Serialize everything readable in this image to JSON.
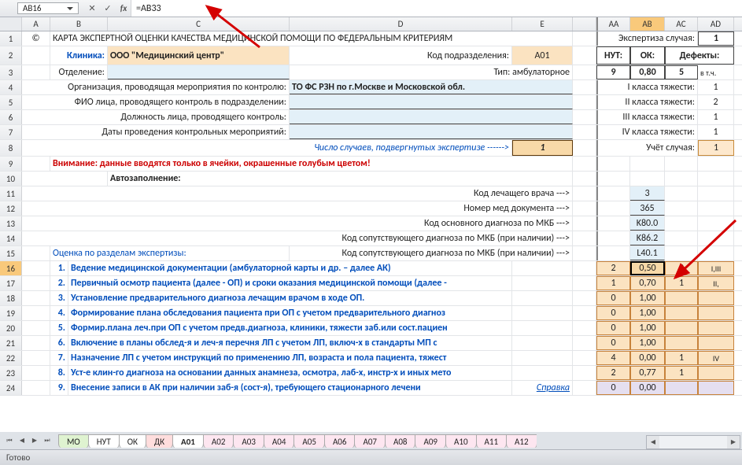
{
  "formula_bar": {
    "name_box": "AB16",
    "formula": "=AB33"
  },
  "columns_left": [
    "A",
    "B",
    "C",
    "D",
    "E"
  ],
  "columns_right": [
    "AA",
    "AB",
    "AC",
    "AD"
  ],
  "row_numbers": [
    1,
    2,
    3,
    4,
    5,
    6,
    7,
    8,
    9,
    10,
    11,
    12,
    13,
    14,
    15,
    16,
    17,
    18,
    19,
    20,
    21,
    22,
    23,
    24
  ],
  "r1": {
    "copyright": "©",
    "title": "КАРТА ЭКСПЕРТНОЙ ОЦЕНКИ КАЧЕСТВА МЕДИЦИНСКОЙ ПОМОЩИ ПО ФЕДЕРАЛЬНЫМ КРИТЕРИЯМ",
    "exp": "Экспертиза случая:",
    "expval": "1"
  },
  "r2": {
    "klinika": "Клиника:",
    "name": "ООО \"Медицинский центр\"",
    "kod": "Код подразделения:",
    "kodval": "A01",
    "nut": "НУТ:",
    "ok": "ОК:",
    "def": "Дефекты:"
  },
  "r3": {
    "otd": "Отделение:",
    "tip": "Тип: амбулаторное",
    "nutv": "9",
    "okv": "0,80",
    "defv": "5",
    "vtch": "в т.ч."
  },
  "r4": {
    "label": "Организация, проводящая мероприятия по контролю:",
    "val": "ТО ФС РЗН по г.Москве и Московской обл.",
    "cls": "I класса тяжести:",
    "clsv": "1"
  },
  "r5": {
    "label": "ФИО лица, проводящего контроль в подразделении:",
    "cls": "II класса тяжести:",
    "clsv": "2"
  },
  "r6": {
    "label": "Должность лица, проводящего контроль:",
    "cls": "III класса тяжести:",
    "clsv": "1"
  },
  "r7": {
    "label": "Даты проведения контрольных мероприятий:",
    "cls": "IV класса тяжести:",
    "clsv": "1"
  },
  "r8": {
    "label": "Число случаев, подвергнутых экспертизе ------>",
    "val": "1",
    "uchet": "Учёт случая:",
    "uchv": "1"
  },
  "r9": {
    "txt": "Внимание: данные вводятся только в ячейки, окрашенные голубым цветом!"
  },
  "r10": {
    "txt": "Автозаполнение:"
  },
  "r11": {
    "lab": "Код лечащего врача --->",
    "val": "3"
  },
  "r12": {
    "lab": "Номер мед документа --->",
    "val": "365"
  },
  "r13": {
    "lab": "Код основного диагноза по МКБ --->",
    "val": "K80.0"
  },
  "r14": {
    "lab": "Код сопутствующего диагноза по МКБ (при наличии) --->",
    "val": "K86.2"
  },
  "r15": {
    "left": "Оценка по разделам экспертизы:",
    "lab": "Код сопутствующего диагноза по МКБ (при наличии) --->",
    "val": "L40.1"
  },
  "sections": [
    {
      "n": "1.",
      "t": "Ведение медицинской документации (амбулаторной карты и др. – далее АК)",
      "aa": "2",
      "ab": "0,50",
      "ac": "2",
      "ad": "I,III"
    },
    {
      "n": "2.",
      "t": "Первичный осмотр пациента (далее - ОП) и сроки оказания медицинской помощи (далее -",
      "aa": "1",
      "ab": "0,70",
      "ac": "1",
      "ad": "II,"
    },
    {
      "n": "3.",
      "t": "Установление предварительного диагноза лечащим врачом в ходе ОП.",
      "aa": "0",
      "ab": "1,00",
      "ac": "",
      "ad": ""
    },
    {
      "n": "4.",
      "t": "Формирование плана обследования пациента при ОП с учетом предварительного диагноз",
      "aa": "0",
      "ab": "1,00",
      "ac": "",
      "ad": ""
    },
    {
      "n": "5.",
      "t": "Формир.плана леч.при ОП с  учетом предв.диагноза, клиники, тяжести заб.или сост.пациен",
      "aa": "0",
      "ab": "1,00",
      "ac": "",
      "ad": ""
    },
    {
      "n": "6.",
      "t": "Включение в планы обслед-я и леч-я перечня ЛП с учетом ЛП, включ-х в стандарты МП с",
      "aa": "0",
      "ab": "1,00",
      "ac": "",
      "ad": ""
    },
    {
      "n": "7.",
      "t": "Назначение ЛП с учетом инструкций по применению ЛП, возраста и пола пациента, тяжест",
      "aa": "4",
      "ab": "0,00",
      "ac": "1",
      "ad": "IV"
    },
    {
      "n": "8.",
      "t": "Уст-е клин-го диагноза на основании данных анамнеза, осмотра, лаб-х, инстр-х и иных мето",
      "aa": "2",
      "ab": "0,77",
      "ac": "1",
      "ad": ""
    },
    {
      "n": "9.",
      "t": "Внесение записи в АК при наличии заб-я (сост-я), требующего стационарного лечени",
      "aa": "0",
      "ab": "0,00",
      "ac": "",
      "ad": ""
    }
  ],
  "spravka": "Справка",
  "tabs": [
    "МО",
    "НУТ",
    "ОК",
    "ДК",
    "A01",
    "A02",
    "A03",
    "A04",
    "A05",
    "A06",
    "A07",
    "A08",
    "A09",
    "A10",
    "A11",
    "A12"
  ],
  "active_tab": "A01",
  "status": "Готово"
}
